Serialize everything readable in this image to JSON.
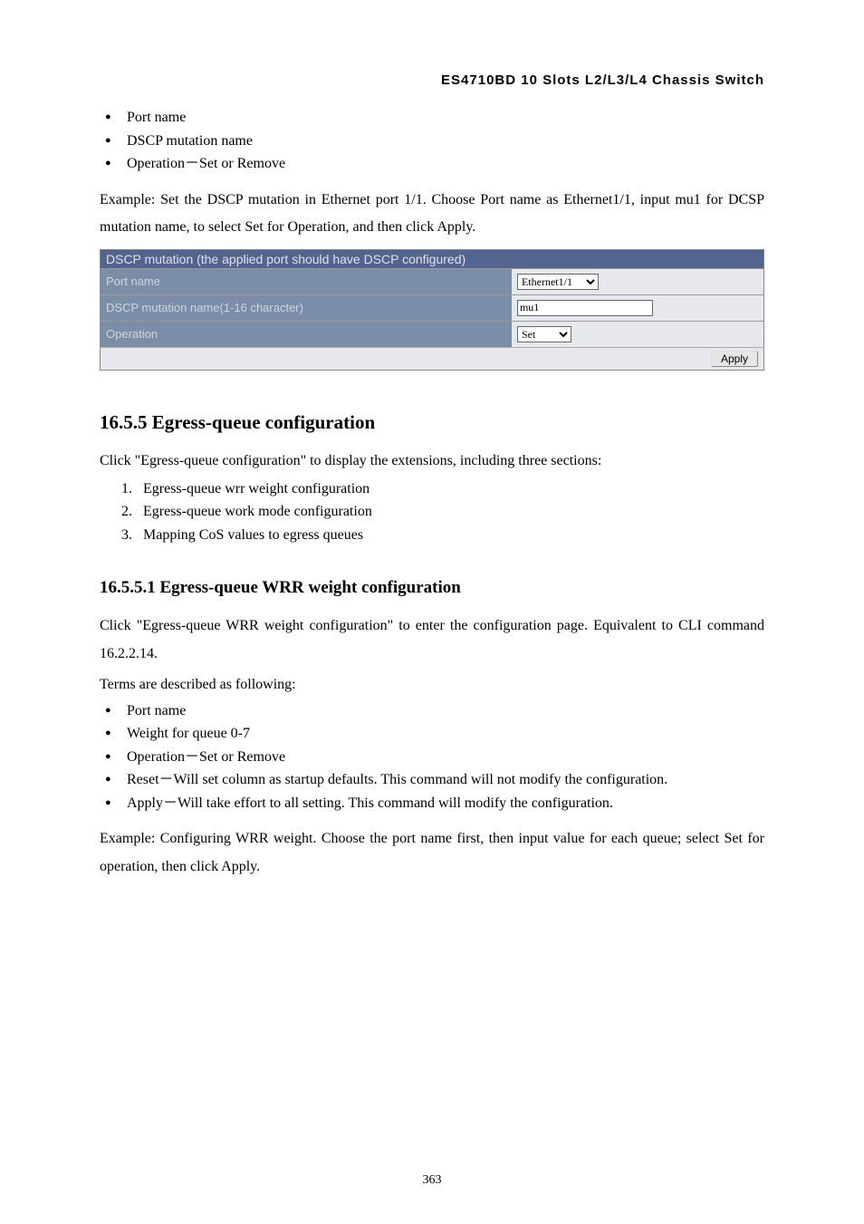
{
  "header": {
    "product": "ES4710BD 10 Slots L2/L3/L4 Chassis Switch"
  },
  "intro_bullets": [
    "Port name",
    "DSCP mutation name",
    "Operation－Set or Remove"
  ],
  "example_text": "Example: Set the DSCP mutation in Ethernet port 1/1. Choose Port name as Ethernet1/1, input mu1 for DCSP mutation name, to select Set for Operation, and then click Apply.",
  "form": {
    "title": "DSCP mutation (the applied port should have DSCP configured)",
    "rows": {
      "portname_label": "Port name",
      "portname_value": "Ethernet1/1",
      "mutation_label": "DSCP mutation name(1-16 character)",
      "mutation_value": "mu1",
      "operation_label": "Operation",
      "operation_value": "Set"
    },
    "apply_label": "Apply"
  },
  "sec1655": {
    "heading": "16.5.5 Egress-queue configuration",
    "intro": "Click \"Egress-queue configuration\" to display the extensions, including three sections:",
    "items": [
      "Egress-queue wrr weight configuration",
      "Egress-queue work mode configuration",
      "Mapping CoS values to egress queues"
    ]
  },
  "sec16551": {
    "heading": "16.5.5.1 Egress-queue WRR weight configuration",
    "para1": "Click \"Egress-queue WRR weight configuration\" to enter the configuration page. Equivalent to CLI command 16.2.2.14.",
    "terms_intro": "Terms are described as following:",
    "bullets": [
      "Port name",
      "Weight for queue 0-7",
      "Operation－Set or Remove",
      "Reset－Will set column as startup defaults. This command will not modify the configuration.",
      "Apply－Will take effort to all setting. This command will modify the configuration."
    ],
    "example": "Example: Configuring WRR weight. Choose the port name first, then input value for each queue; select Set for operation, then click Apply."
  },
  "page_number": "363"
}
